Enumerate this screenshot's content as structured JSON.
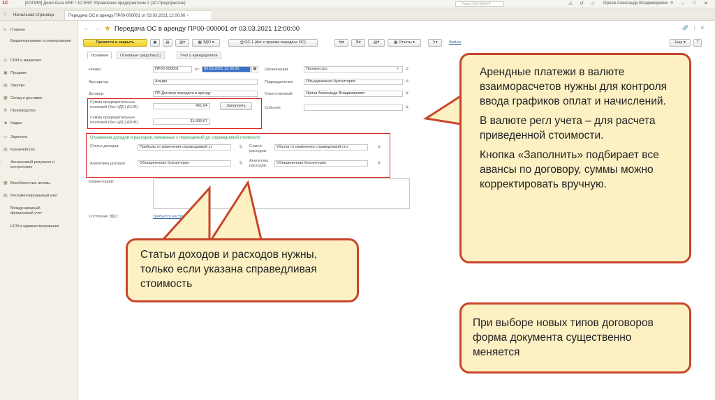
{
  "titlebar": {
    "logo": "1C",
    "title": "[КОПИЯ] Демо-база ERP / 1С:ERP Управление предприятием 2  (1С:Предприятие)",
    "search_placeholder": "Поиск Ctrl+Shift+F",
    "user": "Орлов Александр Владимирович"
  },
  "tabs": [
    "Начальная страница",
    "Передача ОС в аренду ПР00-000001 от 03.03.2021 12:00:00"
  ],
  "sidebar": [
    "Главное",
    "Бюджетирование и планирование",
    "CRM и маркетинг",
    "Продажи",
    "Закупки",
    "Склад и доставка",
    "Производство",
    "Кадры",
    "Зарплата",
    "Казначейство",
    "Финансовый результат и контроллинг",
    "Внеоборотные активы",
    "Регламентированный учет",
    "Международный финансовый учет",
    "НСИ и администрирование"
  ],
  "form": {
    "title": "Передача ОС в аренду ПР00-000001 от 03.03.2021 12:00:00",
    "btn_post_close": "Провести и закрыть",
    "btn_edo": "ЭДО",
    "btn_os1": "ОС-1 (Акт о приеме-передаче ОС)",
    "btn_reports": "Отчеты",
    "btn_files": "Файлы",
    "btn_more": "Еще",
    "form_tabs": [
      "Основное",
      "Основные средства (1)",
      "Учет у арендодателя"
    ],
    "number_label": "Номер:",
    "number_value": "ПР00-000001",
    "from_label": "от:",
    "date_value": "03.03.2021 12:00:00",
    "org_label": "Организация:",
    "org_value": "Промресурс",
    "tenant_label": "Арендатор:",
    "tenant_value": "Альфа",
    "dept_label": "Подразделение:",
    "dept_value": "Объединенная бухгалтерия",
    "contract_label": "Договор:",
    "contract_value": "ПР Договор передачи в аренду",
    "resp_label": "Ответственный:",
    "resp_value": "Орлов Александр Владимирович",
    "sum_eur_label": "Сумма предварительных платежей (без НДС) (EUR):",
    "sum_eur_value": "461,04",
    "fill_button": "Заполнить",
    "sum_rub_label": "Сумма предварительных платежей (без НДС) (RUB):",
    "sum_rub_value": "31 666,67",
    "event_label": "Событие:",
    "section_title": "Отражение доходов и расходов, связанных с переоценкой до справедливой стоимости",
    "income_article_label": "Статья доходов:",
    "income_article_value": "Прибыль от изменения справедливой ст",
    "expense_article_label": "Статья расходов:",
    "expense_article_value": "Убытки от изменения справедливой сто",
    "income_analytics_label": "Аналитика доходов:",
    "income_analytics_value": "Объединенная бухгалтерия",
    "expense_analytics_label": "Аналитика расходов:",
    "expense_analytics_value": "Объединенная бухгалтерия",
    "comment_label": "Комментарий:",
    "edo_state_label": "Состояние ЭДО:",
    "edo_state_value": "Требуется настройка"
  },
  "callouts": {
    "right_p1": "Арендные платежи в валюте взаиморасчетов нужны для контроля ввода графиков оплат и начислений.",
    "right_p2": "В валюте регл учета – для расчета приведенной стоимости.",
    "right_p3": "Кнопка «Заполнить» подбирает все авансы по договору, суммы можно корректировать вручную.",
    "left": "Статьи доходов и расходов нужны, только если указана справедливая стоимость",
    "bottom": "При выборе новых типов договоров форма документа существенно меняется"
  },
  "colors": {
    "callout_border": "#c8452a",
    "callout_fill": "#fdf0c3",
    "highlight": "#dd2222",
    "primary_button": "#f2cf2a"
  }
}
